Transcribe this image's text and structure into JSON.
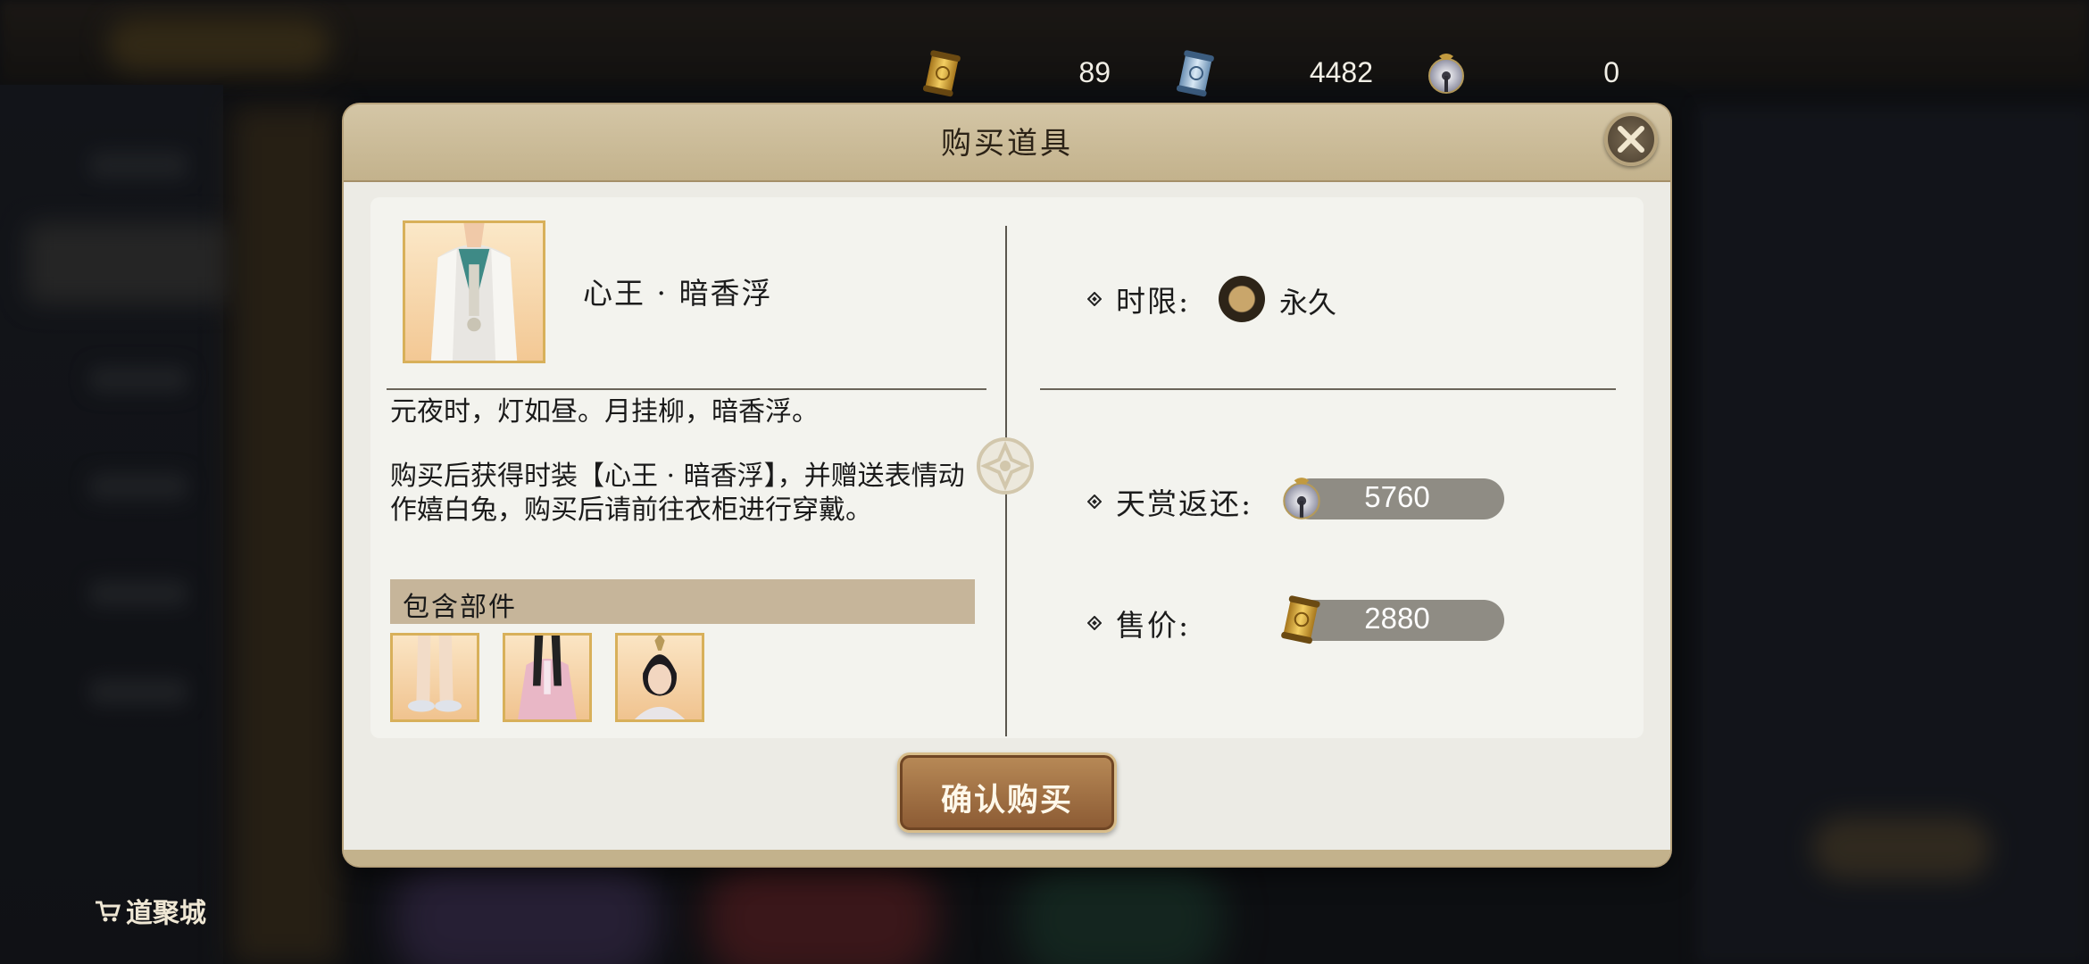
{
  "currencies": [
    {
      "icon": "gold-scroll-icon",
      "value": "89"
    },
    {
      "icon": "blue-scroll-icon",
      "value": "4482"
    },
    {
      "icon": "jade-coin-icon",
      "value": "0"
    }
  ],
  "store": {
    "name": "道聚城"
  },
  "dialog": {
    "title": "购买道具",
    "item": {
      "name": "心王 · 暗香浮",
      "description_line1": "元夜时，灯如昼。月挂柳，暗香浮。",
      "description_line2": "购买后获得时装【心王 · 暗香浮】，并赠送表情动作嬉白兔，购买后请前往衣柜进行穿戴。"
    },
    "parts": {
      "label": "包含部件",
      "items": [
        {
          "icon": "shoes-part-icon"
        },
        {
          "icon": "robe-part-icon"
        },
        {
          "icon": "hairstyle-part-icon"
        }
      ]
    },
    "duration": {
      "label": "时限:",
      "value": "永久"
    },
    "reward": {
      "label": "天赏返还:",
      "value": "5760"
    },
    "price": {
      "label": "售价:",
      "value": "2880"
    },
    "confirm_label": "确认购买"
  },
  "colors": {
    "accent_gold": "#d8b05a",
    "header_tan": "#c3b28c",
    "button_brown": "#8b5a33",
    "pill_gray": "#8f8c84"
  }
}
